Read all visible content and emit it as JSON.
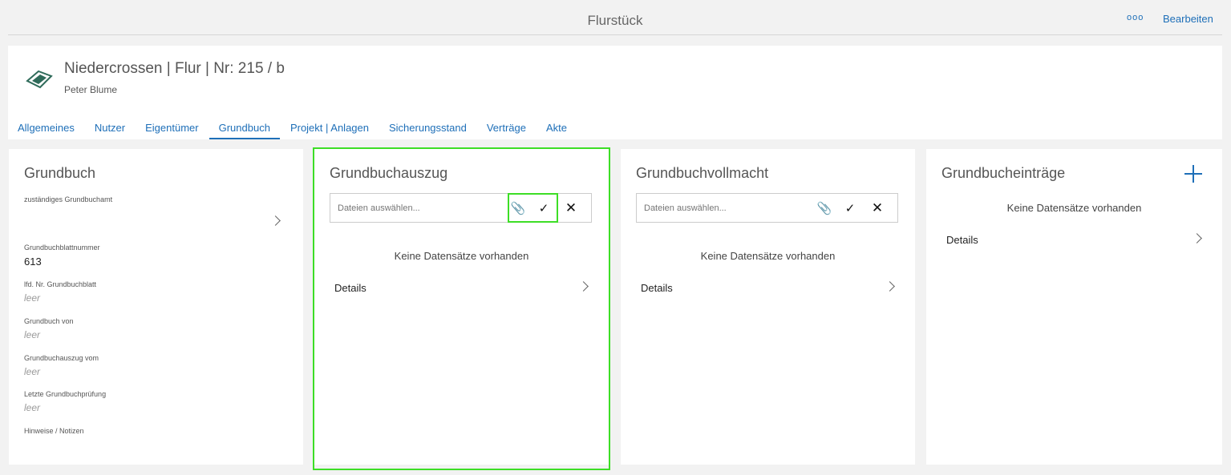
{
  "topbar": {
    "title": "Flurstück",
    "more_icon": "ooo",
    "edit_label": "Bearbeiten"
  },
  "header": {
    "title": "Niedercrossen | Flur | Nr: 215 / b",
    "subtitle": "Peter Blume",
    "tabs": [
      {
        "label": "Allgemeines"
      },
      {
        "label": "Nutzer"
      },
      {
        "label": "Eigentümer"
      },
      {
        "label": "Grundbuch"
      },
      {
        "label": "Projekt | Anlagen"
      },
      {
        "label": "Sicherungsstand"
      },
      {
        "label": "Verträge"
      },
      {
        "label": "Akte"
      }
    ],
    "active_tab": "Grundbuch"
  },
  "grundbuch": {
    "title": "Grundbuch",
    "fields": [
      {
        "label": "zuständiges Grundbuchamt",
        "value": ""
      },
      {
        "label": "Grundbuchblattnummer",
        "value": "613"
      },
      {
        "label": "lfd. Nr. Grundbuchblatt",
        "value": "leer"
      },
      {
        "label": "Grundbuch von",
        "value": "leer"
      },
      {
        "label": "Grundbuchauszug vom",
        "value": "leer"
      },
      {
        "label": "Letzte Grundbuchprüfung",
        "value": "leer"
      },
      {
        "label": "Hinweise / Notizen",
        "value": ""
      }
    ]
  },
  "auszug": {
    "title": "Grundbuchauszug",
    "file_placeholder": "Dateien auswählen...",
    "empty": "Keine Datensätze vorhanden",
    "details": "Details"
  },
  "vollmacht": {
    "title": "Grundbuchvollmacht",
    "file_placeholder": "Dateien auswählen...",
    "empty": "Keine Datensätze vorhanden",
    "details": "Details"
  },
  "eintraege": {
    "title": "Grundbucheinträge",
    "empty": "Keine Datensätze vorhanden",
    "details": "Details"
  },
  "colors": {
    "accent": "#1e6fb8",
    "highlight": "#3dde26",
    "background": "#f2f2f2"
  },
  "icons": {
    "more": "more-icon",
    "paperclip": "paperclip-icon",
    "check": "check-icon",
    "close": "close-icon",
    "chevron": "chevron-right-icon",
    "plus": "plus-icon"
  }
}
